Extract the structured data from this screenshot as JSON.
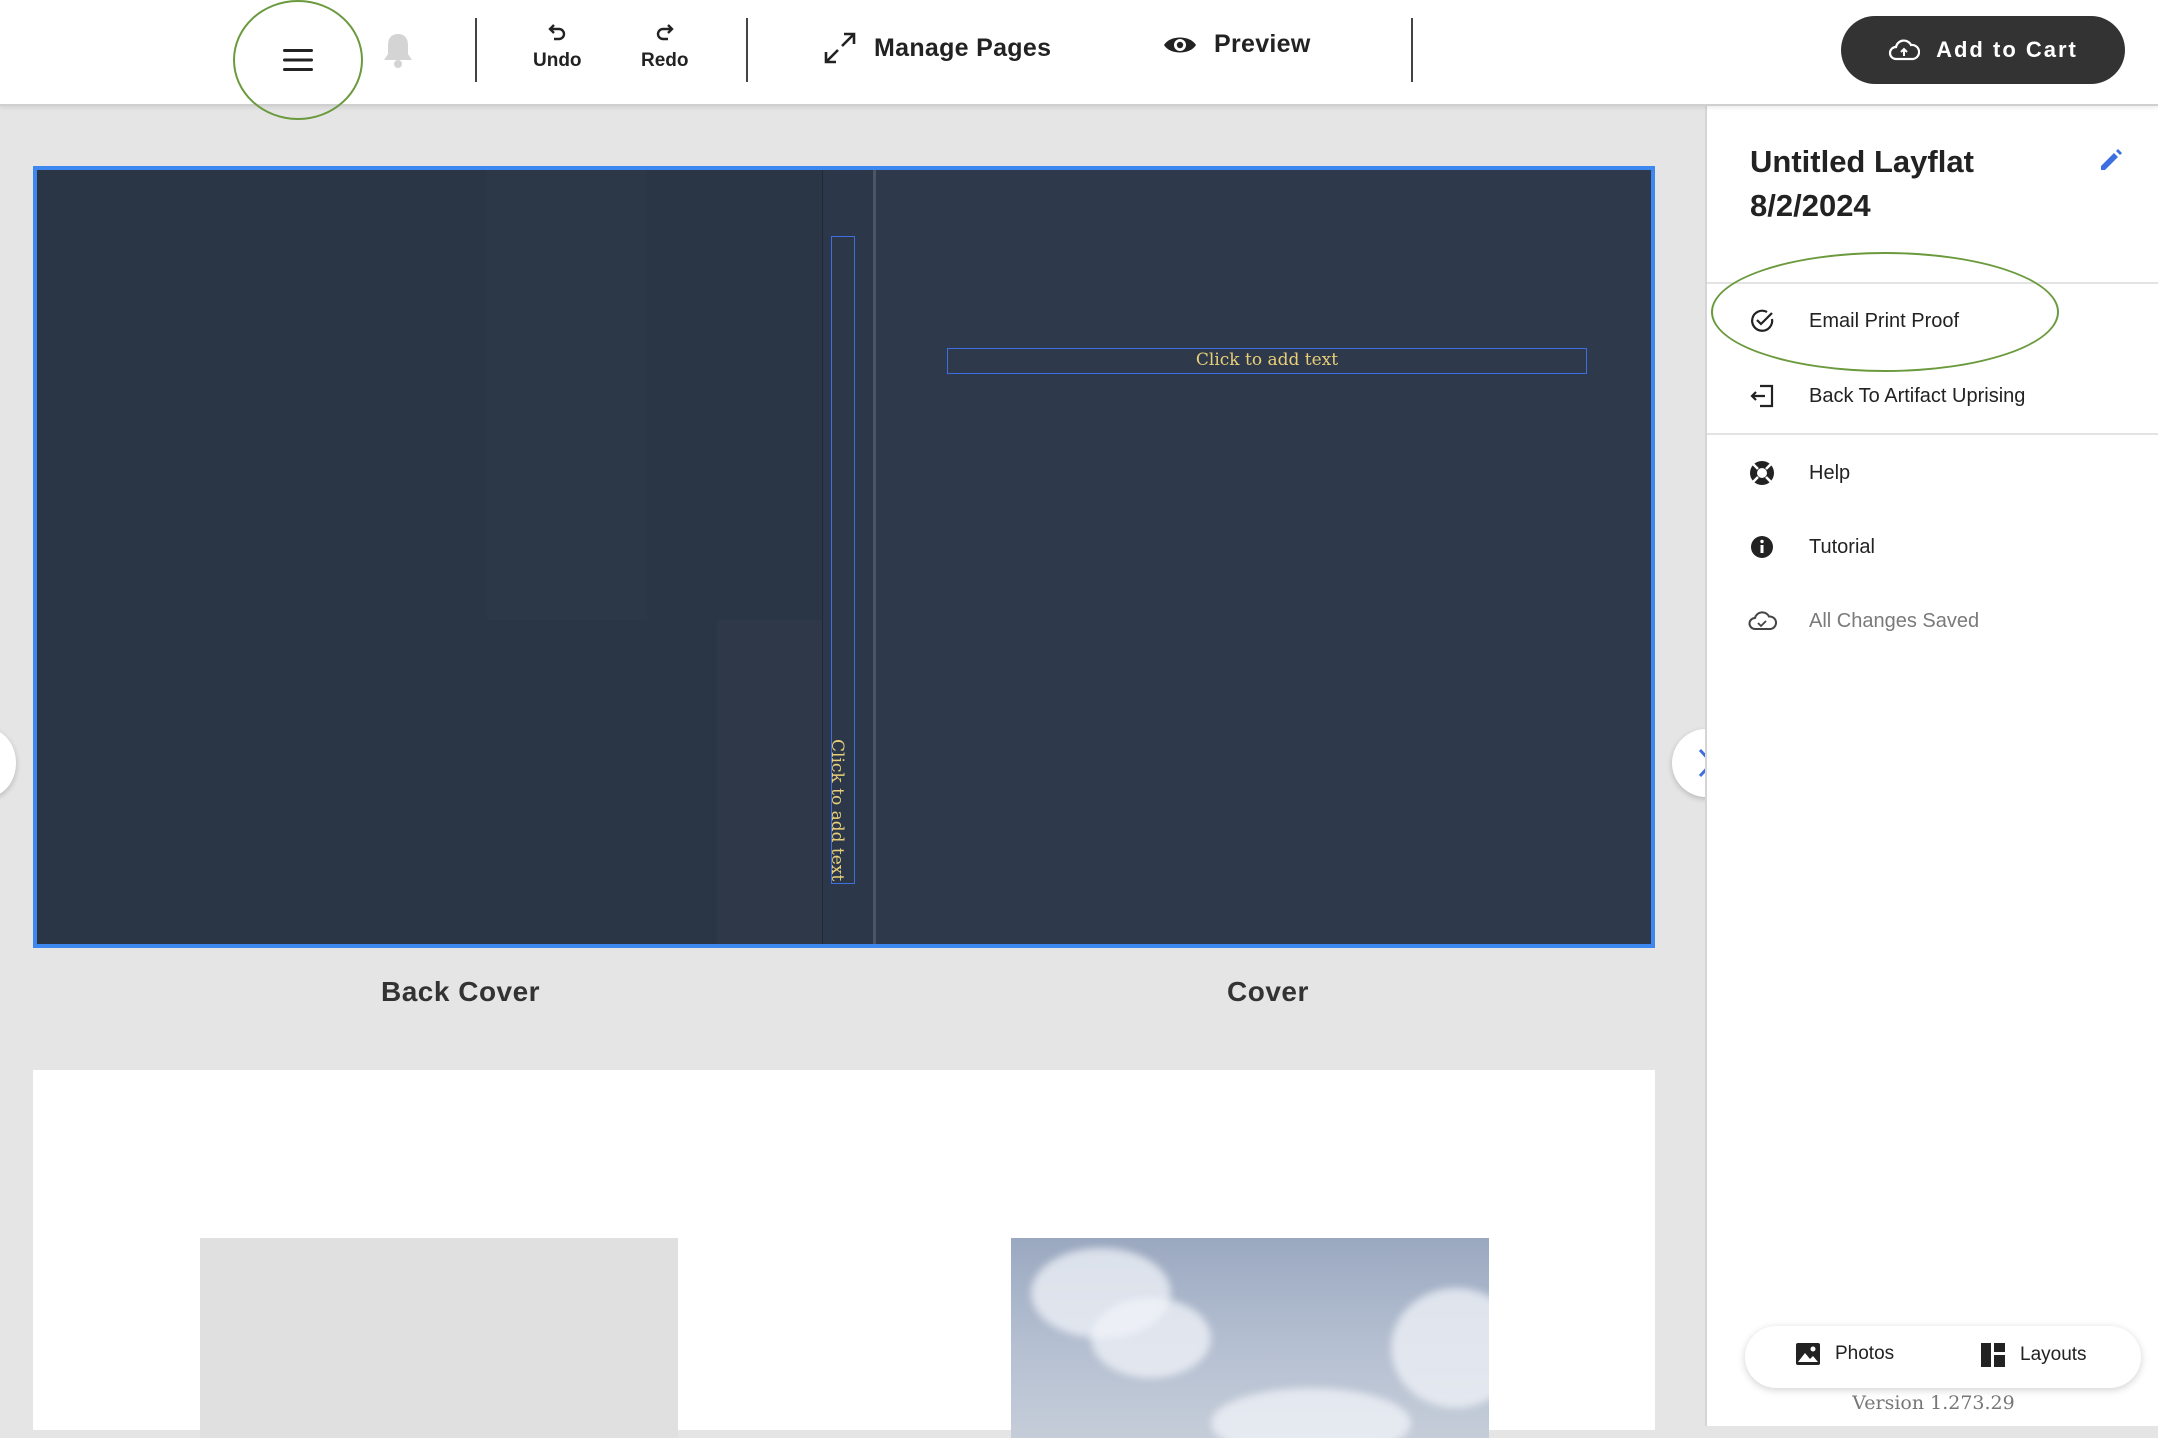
{
  "toolbar": {
    "undo_label": "Undo",
    "redo_label": "Redo",
    "manage_pages_label": "Manage Pages",
    "preview_label": "Preview",
    "add_to_cart_label": "Add to Cart"
  },
  "canvas": {
    "spine_placeholder": "Click to add text",
    "cover_placeholder": "Click to add text",
    "back_cover_label": "Back Cover",
    "cover_label": "Cover",
    "colors": {
      "cover_bg": "#2a3546",
      "selection": "#3d87f0",
      "placeholder_text": "#e8cf78"
    }
  },
  "sidebar": {
    "title": "Untitled Layflat 8/2/2024",
    "items": [
      {
        "label": "Email Print Proof",
        "icon": "check-circle-icon"
      },
      {
        "label": "Back To Artifact Uprising",
        "icon": "exit-icon"
      },
      {
        "label": "Help",
        "icon": "lifebuoy-icon"
      },
      {
        "label": "Tutorial",
        "icon": "info-icon"
      },
      {
        "label": "All Changes Saved",
        "icon": "cloud-icon"
      }
    ],
    "photos_label": "Photos",
    "layouts_label": "Layouts",
    "version": "Version 1.273.29"
  }
}
